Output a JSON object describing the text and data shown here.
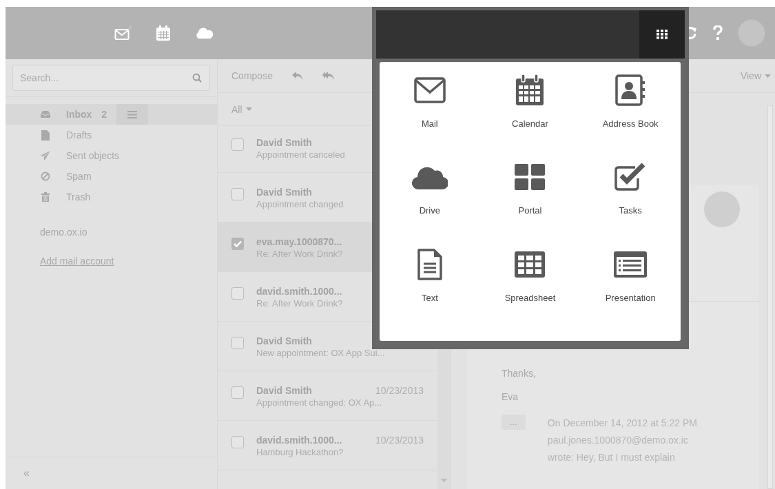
{
  "sidebar": {
    "search": {
      "placeholder": "Search..."
    },
    "folders": [
      {
        "kind": "inbox",
        "label": "Inbox",
        "count": "2",
        "selected": true
      },
      {
        "kind": "drafts",
        "label": "Drafts",
        "selected": false
      },
      {
        "kind": "sent",
        "label": "Sent objects",
        "selected": false
      },
      {
        "kind": "spam",
        "label": "Spam",
        "selected": false
      },
      {
        "kind": "trash",
        "label": "Trash",
        "selected": false
      }
    ],
    "account": "demo.ox.io",
    "add_account": "Add mail account",
    "collapse": "«"
  },
  "list": {
    "compose": "Compose",
    "filter": "All",
    "messages": [
      {
        "sender": "David Smith",
        "subject": "Appointment canceled",
        "checked": false
      },
      {
        "sender": "David Smith",
        "subject": "Appointment changed",
        "checked": false
      },
      {
        "sender": "eva.may.1000870...",
        "subject": "Re: After Work Drink?",
        "checked": true
      },
      {
        "sender": "david.smith.1000...",
        "subject": "Re: After Work Drink?",
        "checked": false
      },
      {
        "sender": "David Smith",
        "subject": "New appointment: OX App Sui...",
        "checked": false
      },
      {
        "sender": "David Smith",
        "date": "10/23/2013",
        "subject": "Appointment changed: OX Ap...",
        "checked": false
      },
      {
        "sender": "david.smith.1000...",
        "date": "10/23/2013",
        "subject": "Hamburg Hackathon?",
        "checked": false
      }
    ]
  },
  "detail": {
    "view": "View",
    "body": [
      "Thanks,",
      "Eva"
    ],
    "quote_toggle": "...",
    "quote": "On December 14, 2012 at 5:22 PM paul.jones.1000870@demo.ox.ic wrote: Hey, But I must explain"
  },
  "launcher": {
    "apps": [
      {
        "kind": "mail",
        "label": "Mail"
      },
      {
        "kind": "calendar",
        "label": "Calendar"
      },
      {
        "kind": "addressbook",
        "label": "Address Book"
      },
      {
        "kind": "drive",
        "label": "Drive"
      },
      {
        "kind": "portal",
        "label": "Portal"
      },
      {
        "kind": "tasks",
        "label": "Tasks"
      },
      {
        "kind": "text",
        "label": "Text"
      },
      {
        "kind": "spreadsheet",
        "label": "Spreadsheet"
      },
      {
        "kind": "presentation",
        "label": "Presentation"
      }
    ]
  }
}
